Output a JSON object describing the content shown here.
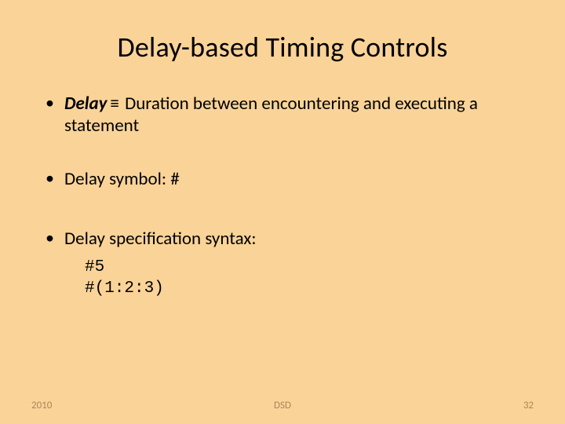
{
  "title": "Delay-based Timing Controls",
  "bullets": {
    "b1_prefix": "Delay",
    "b1_equiv": "≡",
    "b1_rest": " Duration between encountering and executing a statement",
    "b2": "Delay symbol: #",
    "b3": "Delay specification syntax:"
  },
  "code": "#5\n#(1:2:3)",
  "footer": {
    "year": "2010",
    "mid": "DSD",
    "page": "32"
  }
}
